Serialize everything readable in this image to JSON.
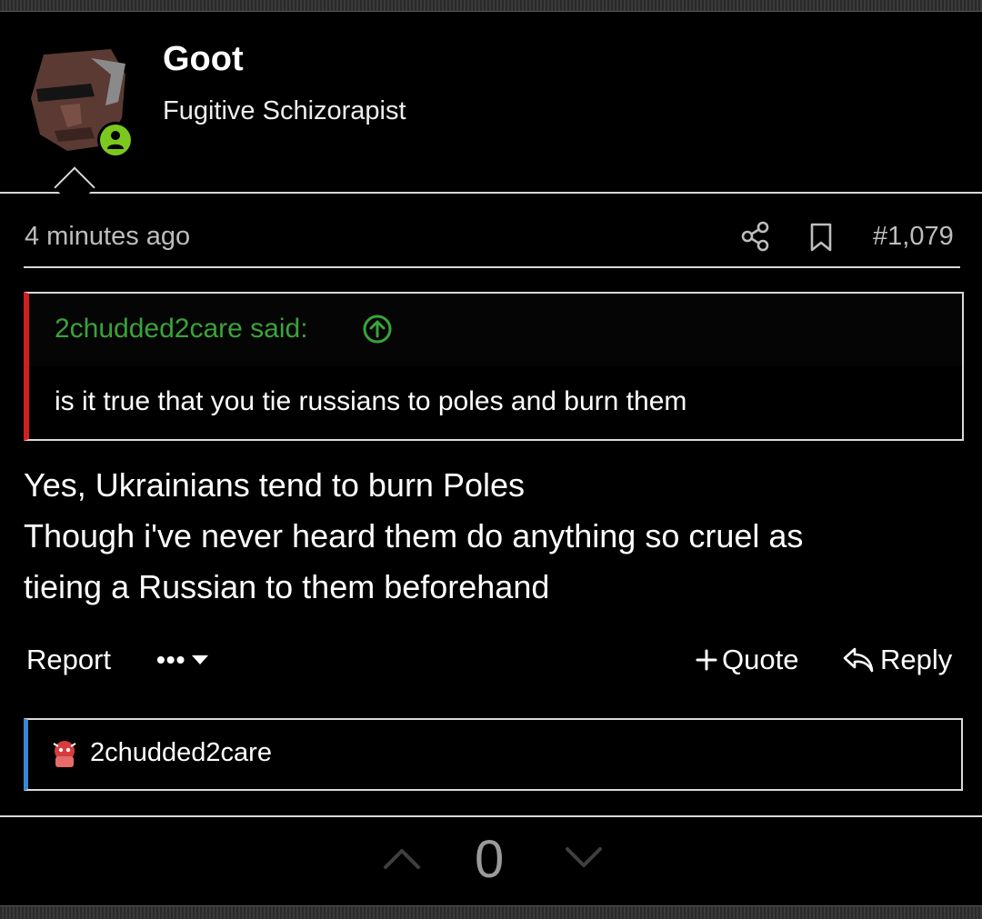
{
  "user": {
    "name": "Goot",
    "title": "Fugitive Schizorapist"
  },
  "post": {
    "timestamp": "4 minutes ago",
    "number": "#1,079",
    "quote": {
      "author_line": "2chudded2care said:",
      "text": "is it true that you tie russians to poles and burn them"
    },
    "message_lines": [
      "Yes, Ukrainians tend to burn Poles",
      "Though i've never heard them do anything so cruel as",
      "tieing a Russian to them beforehand"
    ]
  },
  "actions": {
    "report": "Report",
    "more": "•••",
    "quote": "Quote",
    "reply": "Reply"
  },
  "reactions": {
    "user": "2chudded2care"
  },
  "votes": {
    "count": "0"
  },
  "colors": {
    "quote_accent": "#d11f1f",
    "quote_author": "#3aa33a",
    "reaction_accent": "#3a86d4",
    "online_status": "#7cc81e"
  },
  "icons": [
    "share-icon",
    "bookmark-icon",
    "arrow-up-circle-icon",
    "chevron-down-icon",
    "plus-icon",
    "reply-icon",
    "upvote-icon",
    "downvote-icon",
    "person-icon"
  ]
}
